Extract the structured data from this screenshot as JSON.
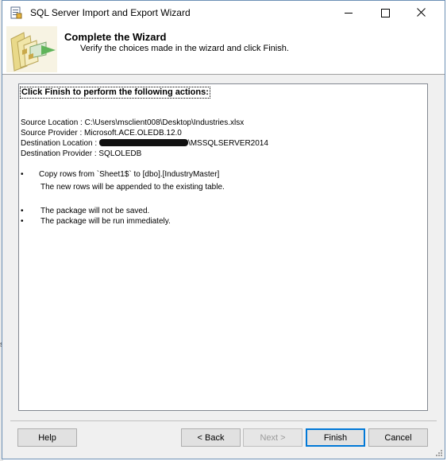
{
  "window": {
    "title": "SQL Server Import and Export Wizard"
  },
  "header": {
    "title": "Complete the Wizard",
    "subtitle": "Verify the choices made in the wizard and click Finish."
  },
  "content": {
    "heading": "Click Finish to perform the following actions:",
    "source_location": "Source Location : C:\\Users\\msclient008\\Desktop\\Industries.xlsx",
    "source_provider": "Source Provider : Microsoft.ACE.OLEDB.12.0",
    "destination_location_prefix": "Destination Location : ",
    "destination_location_suffix": "\\MSSQLSERVER2014",
    "destination_provider": "Destination Provider : SQLOLEDB",
    "bullet_symbol": "•",
    "copy_line": "Copy rows from `Sheet1$` to [dbo].[IndustryMaster]",
    "copy_detail": "The new rows will be appended to the existing table.",
    "package_not_saved": "The package will not be saved.",
    "package_run": "The package will be run immediately."
  },
  "buttons": {
    "help": "Help",
    "back": "< Back",
    "next": "Next >",
    "finish": "Finish",
    "cancel": "Cancel"
  },
  "edge_mark": "s"
}
